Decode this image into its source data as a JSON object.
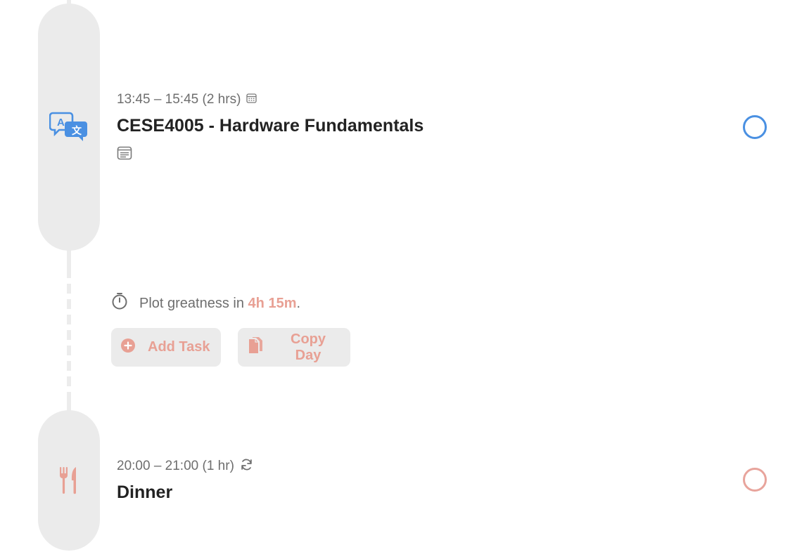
{
  "events": [
    {
      "time": "13:45 – 15:45 (2 hrs)",
      "title": "CESE4005 - Hardware Fundamentals",
      "icon": "translate-icon",
      "time_icon": "calendar-icon",
      "has_note": true,
      "accent_color": "#4a90e2"
    },
    {
      "time": "20:00 – 21:00 (1 hr)",
      "title": "Dinner",
      "icon": "fork-knife-icon",
      "time_icon": "repeat-icon",
      "accent_color": "#e8a49c"
    }
  ],
  "gap": {
    "prefix": "Plot greatness in",
    "duration": "4h 15m",
    "suffix": "."
  },
  "actions": {
    "add_task": "Add Task",
    "copy_day": "Copy Day"
  },
  "colors": {
    "accent": "#e8a094",
    "pill_bg": "#ebebeb",
    "blue": "#4a90e2"
  }
}
